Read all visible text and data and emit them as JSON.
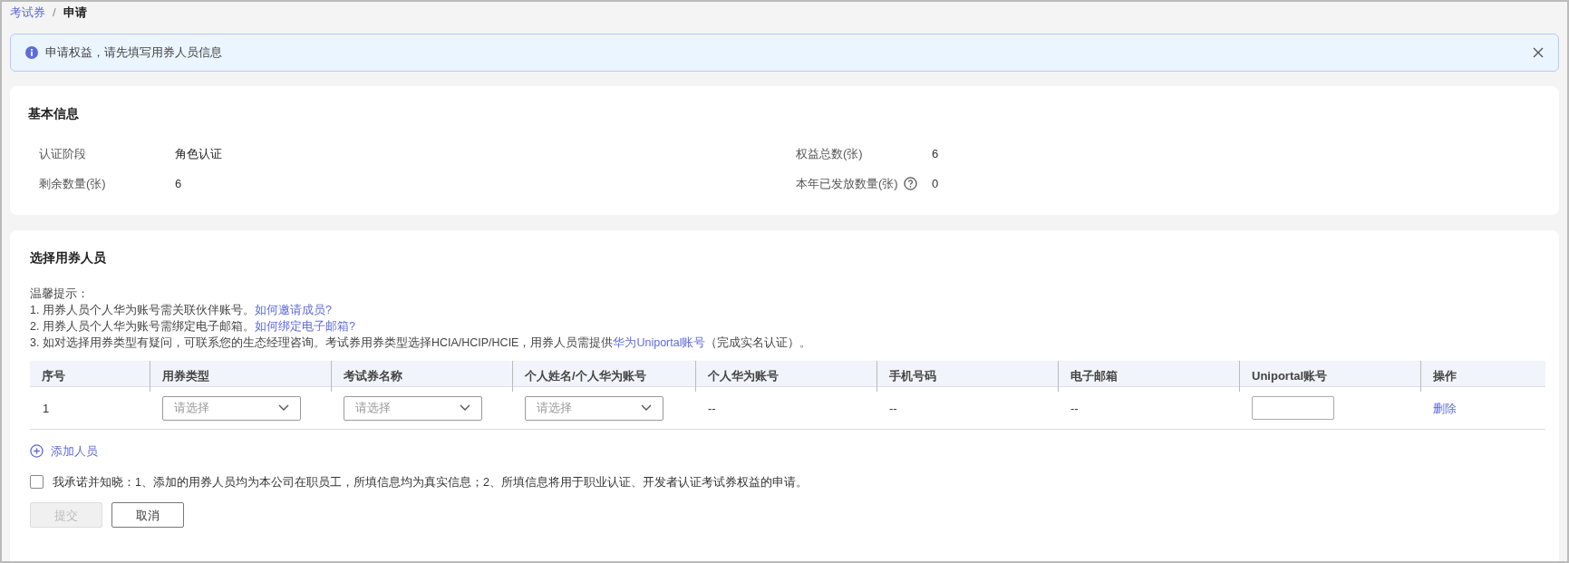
{
  "breadcrumb": [
    {
      "label": "考试券",
      "current": false
    },
    {
      "label": "申请",
      "current": true
    }
  ],
  "breadcrumb_separator": "/",
  "alert": {
    "message": "申请权益，请先填写用券人员信息"
  },
  "basic_info": {
    "title": "基本信息",
    "fields": [
      {
        "label": "认证阶段",
        "value": "角色认证",
        "help": false
      },
      {
        "label": "权益总数(张)",
        "value": "6",
        "help": false
      },
      {
        "label": "剩余数量(张)",
        "value": "6",
        "help": false
      },
      {
        "label": "本年已发放数量(张)",
        "value": "0",
        "help": true
      }
    ]
  },
  "select_users": {
    "title": "选择用券人员",
    "tips_title": "温馨提示：",
    "tips": [
      {
        "text": "1. 用券人员个人华为账号需关联伙伴账号。",
        "link": "如何邀请成员?"
      },
      {
        "text": "2. 用券人员个人华为账号需绑定电子邮箱。",
        "link": "如何绑定电子邮箱?"
      },
      {
        "text": "3. 如对选择用券类型有疑问，可联系您的生态经理咨询。考试券用券类型选择HCIA/HCIP/HCIE，用券人员需提供",
        "link": "华为Uniportal账号",
        "suffix": "（完成实名认证）。"
      }
    ],
    "table": {
      "columns": [
        "序号",
        "用券类型",
        "考试券名称",
        "个人姓名/个人华为账号",
        "个人华为账号",
        "手机号码",
        "电子邮箱",
        "Uniportal账号",
        "操作"
      ],
      "rows": [
        [
          {
            "kind": "text",
            "text": "1"
          },
          {
            "kind": "select",
            "placeholder": "请选择"
          },
          {
            "kind": "select",
            "placeholder": "请选择"
          },
          {
            "kind": "select",
            "placeholder": "请选择"
          },
          {
            "kind": "text",
            "text": "--"
          },
          {
            "kind": "text",
            "text": "--"
          },
          {
            "kind": "text",
            "text": "--"
          },
          {
            "kind": "input"
          },
          {
            "kind": "link",
            "text": "删除"
          }
        ]
      ]
    },
    "add_button": "添加人员",
    "agreement": {
      "checked": false,
      "text": "我承诺并知晓：1、添加的用券人员均为本公司在职员工，所填信息均为真实信息；2、所填信息将用于职业认证、开发者认证考试券权益的申请。"
    },
    "buttons": [
      {
        "label": "提交",
        "kind": "primary",
        "disabled": true
      },
      {
        "label": "取消",
        "kind": "secondary",
        "disabled": false
      }
    ]
  }
}
